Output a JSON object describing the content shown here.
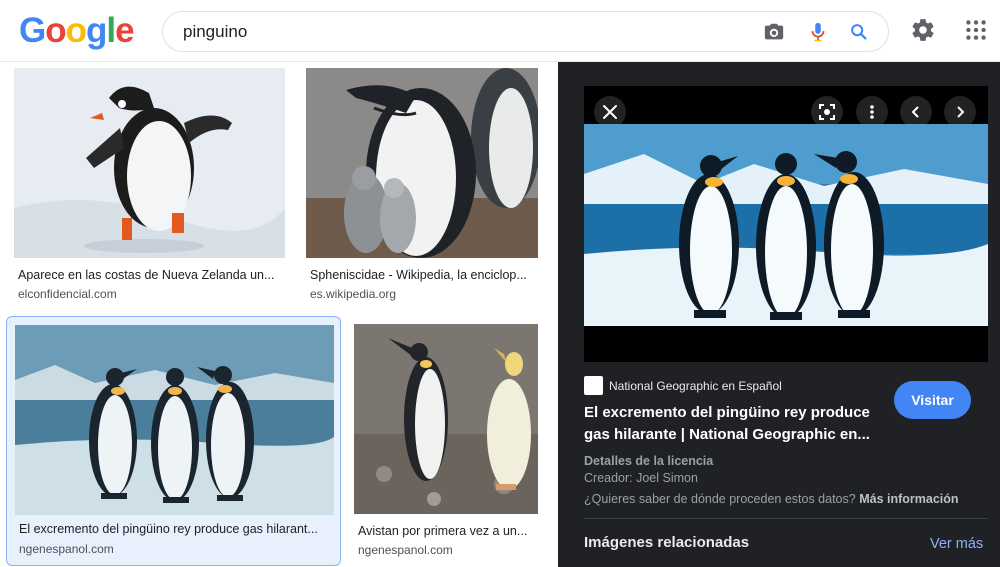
{
  "header": {
    "logo_letters": [
      {
        "char": "G",
        "color": "#4285f4"
      },
      {
        "char": "o",
        "color": "#ea4335"
      },
      {
        "char": "o",
        "color": "#fbbc05"
      },
      {
        "char": "g",
        "color": "#4285f4"
      },
      {
        "char": "l",
        "color": "#34a853"
      },
      {
        "char": "e",
        "color": "#ea4335"
      }
    ],
    "search_value": "pinguino",
    "icons": {
      "camera": "camera-icon",
      "mic": "mic-icon",
      "search": "search-icon",
      "settings": "gear-icon",
      "apps": "apps-grid-icon"
    }
  },
  "results": [
    {
      "caption": "Aparece en las costas de Nueva Zelanda un...",
      "source": "elconfidencial.com"
    },
    {
      "caption": "Spheniscidae - Wikipedia, la enciclop...",
      "source": "es.wikipedia.org"
    },
    {
      "caption": "El excremento del pingüino rey produce gas hilarant...",
      "source": "ngenespanol.com"
    },
    {
      "caption": "Avistan por primera vez a un...",
      "source": "ngenespanol.com"
    }
  ],
  "panel": {
    "site_name": "National Geographic en Español",
    "visit_label": "Visitar",
    "title_line1": "El excremento del pingüino rey produce",
    "title_line2": "gas hilarante | National Geographic en...",
    "license_heading": "Detalles de la licencia",
    "creator": "Creador: Joel Simon",
    "question": "¿Quieres saber de dónde proceden estos datos?",
    "more_info": "Más información",
    "related_label": "Imágenes relacionadas",
    "see_more": "Ver más"
  },
  "colors": {
    "accent_blue": "#4285f4",
    "link_blue": "#8ab4f8",
    "panel_bg": "#202124",
    "selected_bg": "#e8f0fe"
  }
}
